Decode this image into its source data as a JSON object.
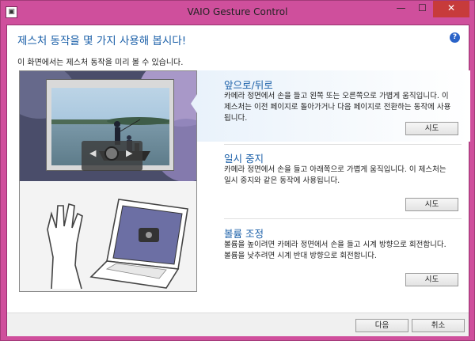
{
  "window": {
    "title": "VAIO Gesture Control",
    "icon_glyph": "▣",
    "minimize_glyph": "—",
    "maximize_glyph": "☐",
    "close_glyph": "✕"
  },
  "page": {
    "heading": "제스처 동작을 몇 가지 사용해 봅시다!",
    "help_glyph": "?",
    "subheading": "이 화면에서는 제스처 동작을 미리 볼 수 있습니다."
  },
  "preview": {
    "left_glyph": "◀",
    "right_glyph": "▶"
  },
  "gestures": [
    {
      "title": "앞으로/뒤로",
      "description": "카메라 정면에서 손을 들고 왼쪽 또는 오른쪽으로 가볍게 움직입니다. 이 제스처는 이전 페이지로 돌아가거나 다음 페이지로 전환하는 동작에 사용됩니다.",
      "button": "시도"
    },
    {
      "title": "일시 중지",
      "description": "카메라 정면에서 손을 들고 아래쪽으로 가볍게 움직입니다. 이 제스처는 일시 중지와 같은 동작에 사용됩니다.",
      "button": "시도"
    },
    {
      "title": "볼륨 조정",
      "description": "볼륨을 높이려면 카메라 정면에서 손을 들고 시계 방향으로 회전합니다. 볼륨을 낮추려면 시계 반대 방향으로 회전합니다.",
      "button": "시도"
    }
  ],
  "footer": {
    "next_label": "다음",
    "cancel_label": "취소"
  },
  "colors": {
    "accent": "#1a5fa8",
    "frame": "#cf4f9c"
  }
}
